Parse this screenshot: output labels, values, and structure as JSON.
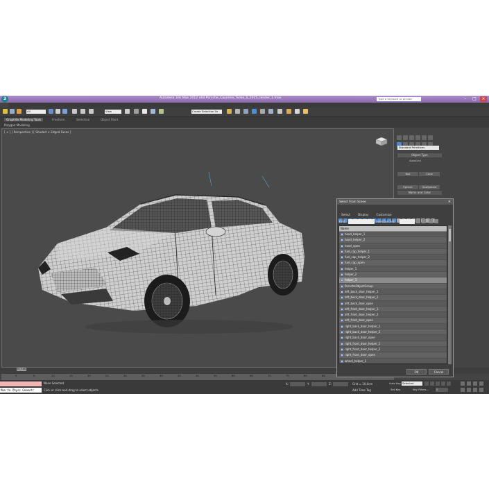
{
  "window": {
    "title": "Autodesk 3ds Max 2012 x64      Porsche_Cayenne_Turbo_S_2015_render_1.max",
    "search_placeholder": "Type a keyword or phrase",
    "logo_text": "3"
  },
  "menubar": [
    "Edit",
    "Tools",
    "Group",
    "Views",
    "Create",
    "Modifiers",
    "Animation",
    "Graph Editors",
    "Rendering",
    "Customize",
    "MAXScript",
    "Help"
  ],
  "toolbar": {
    "selection_filter": "All",
    "reference_coord": "View",
    "named_selection": "Create Selection Se"
  },
  "ribbon": {
    "tabs": [
      "Graphite Modeling Tools",
      "Freeform",
      "Selection",
      "Object Paint"
    ],
    "active_tab": 0,
    "panel_label": "Polygon Modeling"
  },
  "viewport": {
    "label": "[ + ] [ Perspective ] [ Shaded + Edged Faces ]"
  },
  "command_panel": {
    "category": "Standard Primitives",
    "object_type_header": "Object Type",
    "autogrid": "AutoGrid",
    "object_buttons": [
      "Box",
      "Cone",
      "Sphere",
      "GeoSphere",
      "Cylinder",
      "Tube",
      "Torus",
      "Pyramid",
      "Teapot",
      "Plane"
    ],
    "name_color_header": "Name and Color"
  },
  "select_dialog": {
    "title": "Select From Scene",
    "menu": [
      "Select",
      "Display",
      "Customize"
    ],
    "find_label": "Find:",
    "selection_set_label": "Selection Set:",
    "column_header": "Name",
    "items": [
      "hood_helper_1",
      "hood_helper_2",
      "hood_open",
      "fuel_cap_helper_1",
      "fuel_cap_helper_2",
      "fuel_cap_open",
      "helper_1",
      "helper_2",
      "helper_3",
      "PorscheObjectGroup",
      "left_back_door_helper_1",
      "left_back_door_helper_2",
      "left_back_door_open",
      "left_front_door_helper_1",
      "left_front_door_helper_2",
      "left_front_door_open",
      "right_back_door_helper_1",
      "right_back_door_helper_2",
      "right_back_door_open",
      "right_front_door_helper_1",
      "right_front_door_helper_2",
      "right_front_door_open",
      "wheel_helper_1",
      "wheel_helper_2",
      "wheel_rotate",
      "wheel_rotation",
      "wheel_twist"
    ],
    "selected_index": 8,
    "ok_label": "OK",
    "cancel_label": "Cancel"
  },
  "timeline": {
    "slider_label": "0 / 100",
    "ticks": [
      "0",
      "5",
      "10",
      "15",
      "20",
      "25",
      "30",
      "35",
      "40",
      "45",
      "50",
      "55",
      "60",
      "65",
      "70",
      "75",
      "80",
      "85",
      "90",
      "95",
      "100"
    ]
  },
  "status": {
    "maxscript_text": "Max to Physc Geometr",
    "selection_status": "None Selected",
    "prompt": "Click or click-and-drag to select objects",
    "x_label": "X:",
    "y_label": "Y:",
    "z_label": "Z:",
    "grid": "Grid = 10,0cm",
    "add_time_tag": "Add Time Tag",
    "auto_key": "Auto Key",
    "auto_key_value": "Selected",
    "set_key": "Set Key",
    "key_filters": "Key Filters...",
    "frame": "0"
  },
  "colors": {
    "title_bar": "#9a7bbd",
    "viewport_bg": "#4a4a4a",
    "panel_bg": "#444444",
    "maxscript_bg": "#f2b6b6",
    "wire": "#1e1e1e",
    "car_body": "#cfcfcf"
  }
}
